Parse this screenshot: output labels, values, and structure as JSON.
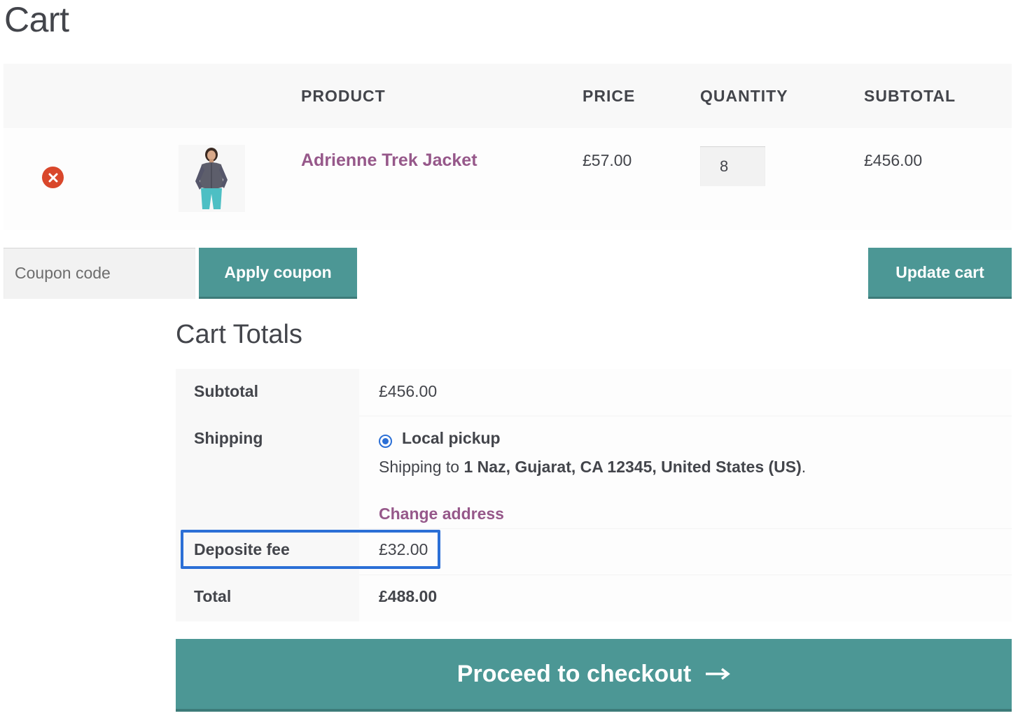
{
  "page": {
    "title": "Cart"
  },
  "cart_table": {
    "headers": {
      "product": "PRODUCT",
      "price": "PRICE",
      "quantity": "QUANTITY",
      "subtotal": "SUBTOTAL"
    },
    "items": [
      {
        "name": "Adrienne Trek Jacket",
        "price": "£57.00",
        "quantity": "8",
        "subtotal": "£456.00",
        "remove_icon": "remove-circle-x-icon"
      }
    ]
  },
  "actions": {
    "coupon_placeholder": "Coupon code",
    "apply_coupon_label": "Apply coupon",
    "update_cart_label": "Update cart"
  },
  "totals": {
    "title": "Cart Totals",
    "subtotal_label": "Subtotal",
    "subtotal_value": "£456.00",
    "shipping_label": "Shipping",
    "shipping_method": "Local pickup",
    "shipping_to_prefix": "Shipping to ",
    "shipping_address": "1 Naz, Gujarat, CA 12345, United States (US)",
    "shipping_to_suffix": ".",
    "change_address_label": "Change address",
    "fee_label": "Deposite fee",
    "fee_value": "£32.00",
    "total_label": "Total",
    "total_value": "£488.00"
  },
  "checkout": {
    "label": "Proceed to checkout",
    "arrow_icon": "right-arrow-icon"
  },
  "colors": {
    "accent_teal": "#4c9795",
    "link_purple": "#96588a",
    "remove_red": "#d9472b",
    "highlight_blue": "#2b6fd6"
  }
}
